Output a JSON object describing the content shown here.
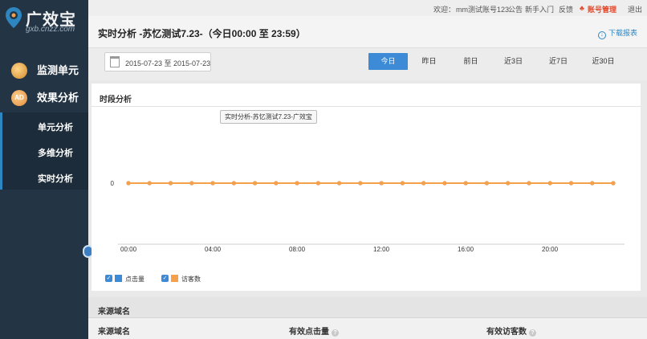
{
  "brand": {
    "name": "广效宝",
    "domain": "gxb.cnzz.com",
    "icon": "location-pin-logo"
  },
  "topbar": {
    "welcome": "欢迎：",
    "username": "mm测试账号123",
    "notice": "公告",
    "newbie": "新手入门",
    "feedback": "反馈",
    "account_mgmt": "账号管理",
    "logout": "退出"
  },
  "sidebar": {
    "items": [
      {
        "label": "监测单元",
        "icon": "magnifier-icon"
      },
      {
        "label": "效果分析",
        "icon": "ad-icon",
        "icon_text": "AD"
      }
    ],
    "sub_items": [
      {
        "label": "单元分析"
      },
      {
        "label": "多维分析"
      },
      {
        "label": "实时分析"
      }
    ]
  },
  "header": {
    "title": "实时分析 -苏忆测试7.23-（今日00:00 至 23:59）",
    "download": "下载报表"
  },
  "filters": {
    "date_range": "2015-07-23 至 2015-07-23",
    "ranges": [
      {
        "label": "今日",
        "active": true
      },
      {
        "label": "昨日",
        "active": false
      },
      {
        "label": "前日",
        "active": false
      },
      {
        "label": "近3日",
        "active": false
      },
      {
        "label": "近7日",
        "active": false
      },
      {
        "label": "近30日",
        "active": false
      }
    ]
  },
  "panel": {
    "title": "时段分析",
    "tooltip": "实时分析-苏忆测试7.23-广效宝"
  },
  "chart_data": {
    "type": "line",
    "x": [
      "00:00",
      "01:00",
      "02:00",
      "03:00",
      "04:00",
      "05:00",
      "06:00",
      "07:00",
      "08:00",
      "09:00",
      "10:00",
      "11:00",
      "12:00",
      "13:00",
      "14:00",
      "15:00",
      "16:00",
      "17:00",
      "18:00",
      "19:00",
      "20:00",
      "21:00",
      "22:00",
      "23:00"
    ],
    "x_tick_labels": [
      "00:00",
      "04:00",
      "08:00",
      "12:00",
      "16:00",
      "20:00"
    ],
    "y_tick_labels": [
      "0"
    ],
    "series": [
      {
        "name": "点击量",
        "color": "#3d8ad6",
        "checked": true,
        "values": [
          0,
          0,
          0,
          0,
          0,
          0,
          0,
          0,
          0,
          0,
          0,
          0,
          0,
          0,
          0,
          0,
          0,
          0,
          0,
          0,
          0,
          0,
          0,
          0
        ]
      },
      {
        "name": "访客数",
        "color": "#f5a04a",
        "checked": true,
        "values": [
          0,
          0,
          0,
          0,
          0,
          0,
          0,
          0,
          0,
          0,
          0,
          0,
          0,
          0,
          0,
          0,
          0,
          0,
          0,
          0,
          0,
          0,
          0,
          0
        ]
      }
    ],
    "grid": false,
    "legend_position": "bottom-left"
  },
  "source": {
    "section_title": "来源域名",
    "columns": [
      "来源域名",
      "有效点击量",
      "有效访客数"
    ]
  },
  "colors": {
    "sidebar": "#233444",
    "accent": "#3d8ad6",
    "orange": "#f5a04a",
    "account": "#e2482b"
  }
}
